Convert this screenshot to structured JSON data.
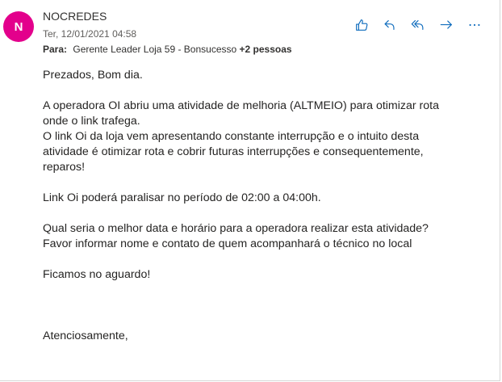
{
  "message": {
    "avatar_initial": "N",
    "avatar_color": "#e3008c",
    "sender": "NOCREDES",
    "date": "Ter, 12/01/2021 04:58",
    "to_label": "Para:",
    "to_recipients": "Gerente Leader Loja 59 - Bonsucesso",
    "to_more": "+2 pessoas"
  },
  "actions": [
    {
      "name": "like-icon"
    },
    {
      "name": "reply-icon"
    },
    {
      "name": "reply-all-icon"
    },
    {
      "name": "forward-icon"
    },
    {
      "name": "more-icon"
    }
  ],
  "accent_color": "#0f6cbd",
  "body": {
    "greeting": "Prezados, Bom dia.",
    "p1_l1": "A operadora OI abriu uma atividade de melhoria (ALTMEIO) para otimizar rota",
    "p1_l2": "onde o link trafega.",
    "p1_l3": "O link Oi da loja vem apresentando constante interrupção e o intuito desta",
    "p1_l4": "atividade é otimizar rota e cobrir futuras interrupções e consequentemente,",
    "p1_l5": "reparos!",
    "p2": "Link Oi poderá paralisar no período de 02:00 a 04:00h.",
    "p3_l1": "Qual seria o melhor data e horário para a operadora realizar esta atividade?",
    "p3_l2": "Favor informar nome e contato de quem acompanhará o técnico no local",
    "p4": "Ficamos no aguardo!",
    "sign": "Atenciosamente,"
  }
}
